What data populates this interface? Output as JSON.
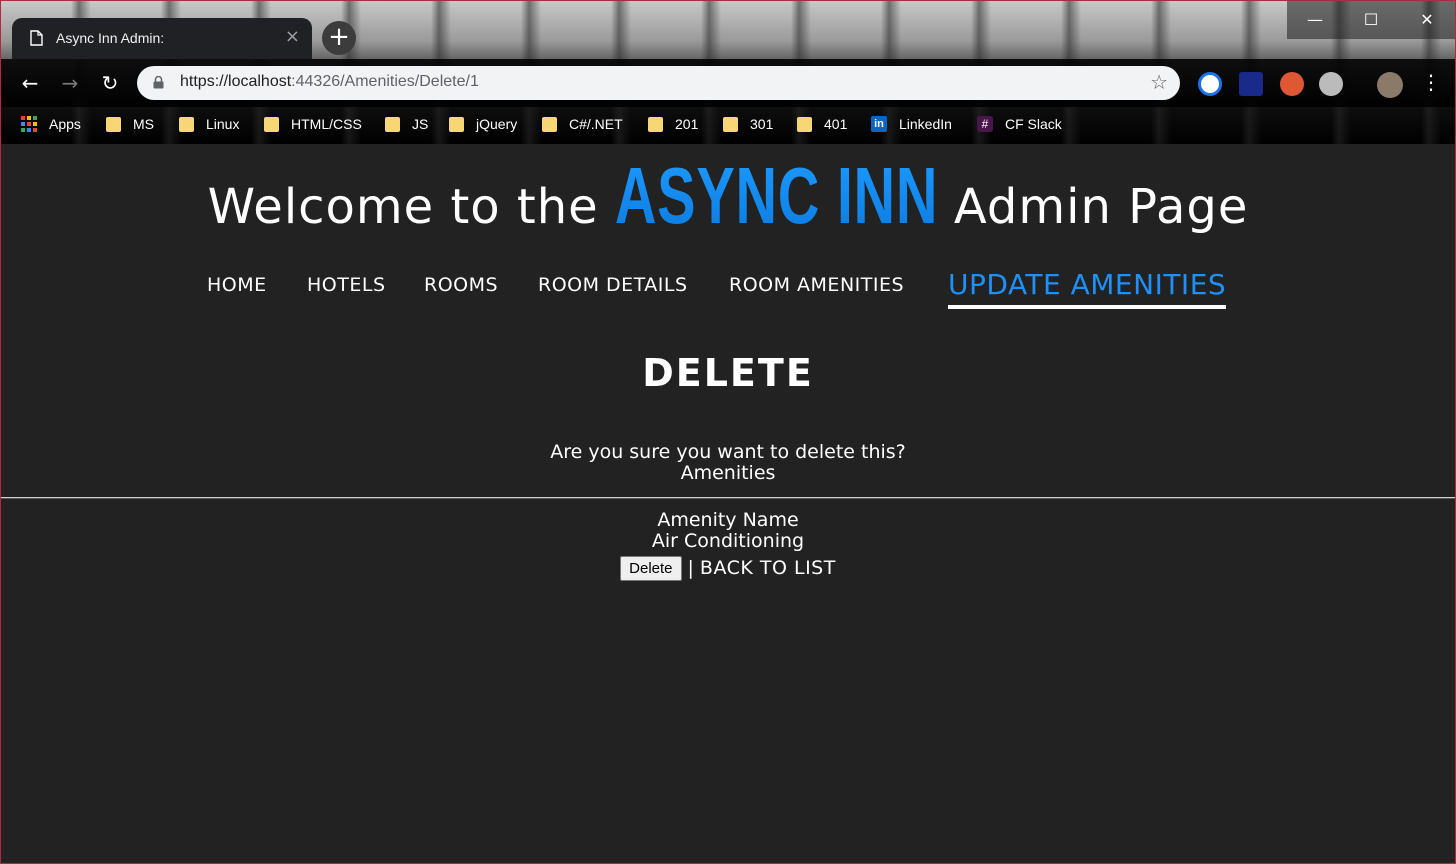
{
  "browser": {
    "tab_title": "Async Inn Admin:",
    "tab_close": "×",
    "new_tab": "+",
    "url_host": "https://localhost",
    "url_rest": ":44326/Amenities/Delete/1",
    "window_min": "—",
    "window_max": "☐",
    "window_close": "✕",
    "bookmarks": [
      {
        "label": "Apps",
        "icon": "apps-grid-icon"
      },
      {
        "label": "MS",
        "icon": "folder-icon"
      },
      {
        "label": "Linux",
        "icon": "folder-icon"
      },
      {
        "label": "HTML/CSS",
        "icon": "folder-icon"
      },
      {
        "label": "JS",
        "icon": "folder-icon"
      },
      {
        "label": "jQuery",
        "icon": "folder-icon"
      },
      {
        "label": "C#/.NET",
        "icon": "folder-icon"
      },
      {
        "label": "201",
        "icon": "folder-icon"
      },
      {
        "label": "301",
        "icon": "folder-icon"
      },
      {
        "label": "401",
        "icon": "folder-icon"
      },
      {
        "label": "LinkedIn",
        "icon": "linkedin-icon"
      },
      {
        "label": "CF Slack",
        "icon": "slack-icon"
      }
    ]
  },
  "header": {
    "welcome_prefix": "Welcome to the",
    "brand": "ASYNC INN",
    "welcome_suffix": "Admin Page"
  },
  "nav": {
    "items": [
      {
        "label": "HOME"
      },
      {
        "label": "HOTELS"
      },
      {
        "label": "ROOMS"
      },
      {
        "label": "ROOM DETAILS"
      },
      {
        "label": "ROOM AMENITIES"
      },
      {
        "label": "UPDATE AMENITIES",
        "active": true
      }
    ]
  },
  "main": {
    "heading": "DELETE",
    "confirm_question": "Are you sure you want to delete this?",
    "entity": "Amenities",
    "field_label": "Amenity Name",
    "field_value": "Air Conditioning",
    "delete_button": "Delete",
    "separator": "|",
    "back_link": "BACK TO LIST"
  },
  "colors": {
    "background": "#222222",
    "accent": "#1e90ff",
    "text": "#ffffff"
  }
}
